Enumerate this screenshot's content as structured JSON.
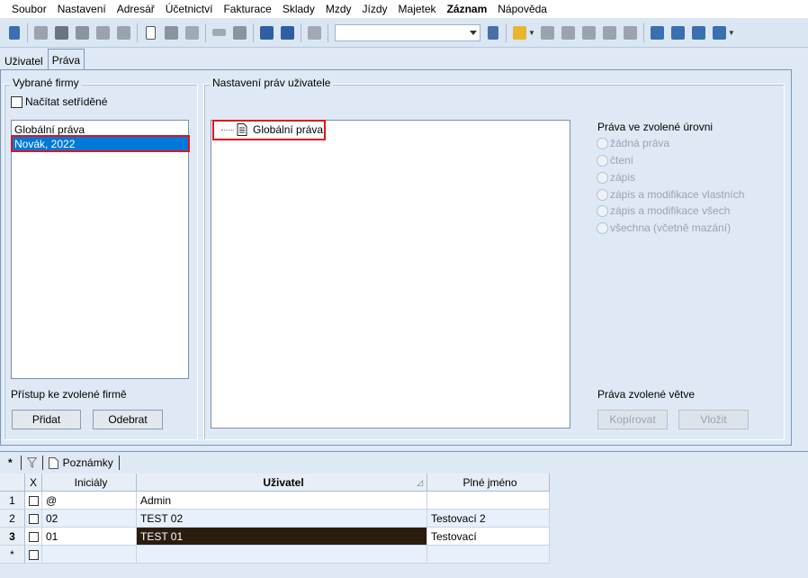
{
  "menu": [
    "Soubor",
    "Nastavení",
    "Adresář",
    "Účetnictví",
    "Fakturace",
    "Sklady",
    "Mzdy",
    "Jízdy",
    "Majetek",
    "Záznam",
    "Nápověda"
  ],
  "tabs": {
    "uzivatel": "Uživatel",
    "prava": "Práva"
  },
  "firms_group": {
    "title": "Vybrané firmy",
    "sorted_checkbox": "Načítat setříděné",
    "items": [
      "Globální práva",
      "Novák, 2022"
    ],
    "access_label": "Přístup ke zvolené firmě",
    "add_button": "Přidat",
    "remove_button": "Odebrat"
  },
  "rights_group": {
    "title": "Nastavení práv uživatele",
    "tree_node": "Globální práva",
    "level_title": "Práva ve zvolené úrovni",
    "options": [
      "žádná práva",
      "čtení",
      "zápis",
      "zápis a modifikace vlastních",
      "zápis a modifikace všech",
      "všechna (včetně mazání)"
    ],
    "branch_title": "Práva zvolené větve",
    "copy_button": "Kopírovat",
    "paste_button": "Vložit"
  },
  "bottom_tabs": {
    "star": "*",
    "notes": "Poznámky"
  },
  "grid": {
    "headers": {
      "x": "X",
      "initials": "Iniciály",
      "user": "Uživatel",
      "fullname": "Plné jméno"
    },
    "rows": [
      {
        "num": "1",
        "initials": "@",
        "user": "Admin",
        "fullname": ""
      },
      {
        "num": "2",
        "initials": "02",
        "user": "TEST 02",
        "fullname": "Testovací 2"
      },
      {
        "num": "3",
        "initials": "01",
        "user": "TEST 01",
        "fullname": "Testovací"
      },
      {
        "num": "*",
        "initials": "",
        "user": "",
        "fullname": ""
      }
    ]
  },
  "colors": {
    "selection": "#0078d7",
    "highlight": "#e0141e",
    "grid_selected": "#2b1d0e"
  }
}
